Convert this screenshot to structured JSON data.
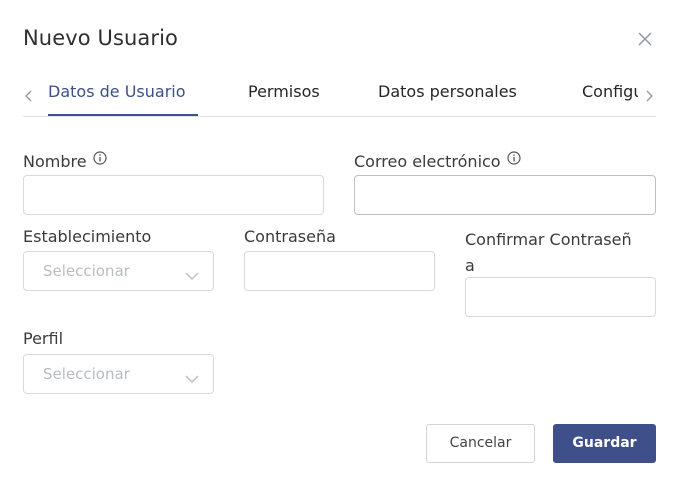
{
  "dialog": {
    "title": "Nuevo Usuario",
    "close_icon": "close-icon"
  },
  "tabs": {
    "items": [
      {
        "label": "Datos de Usuario",
        "active": true
      },
      {
        "label": "Permisos",
        "active": false
      },
      {
        "label": "Datos personales",
        "active": false
      },
      {
        "label": "Configuración",
        "active": false
      }
    ],
    "prev_icon": "chevron-left-icon",
    "next_icon": "chevron-right-icon"
  },
  "form": {
    "nombre": {
      "label": "Nombre",
      "value": "",
      "info_icon": "info-icon"
    },
    "correo": {
      "label": "Correo electrónico",
      "value": "",
      "info_icon": "info-icon"
    },
    "establecimiento": {
      "label": "Establecimiento",
      "placeholder": "Seleccionar"
    },
    "contrasena": {
      "label": "Contraseña",
      "value": ""
    },
    "confirmar": {
      "label_line1": "Confirmar Contraseñ",
      "label_line2": "a",
      "value": ""
    },
    "perfil": {
      "label": "Perfil",
      "placeholder": "Seleccionar"
    }
  },
  "actions": {
    "cancel_label": "Cancelar",
    "save_label": "Guardar"
  },
  "colors": {
    "accent": "#3e4f8a",
    "border": "#d9d9d9",
    "placeholder": "#b8bcc4"
  }
}
